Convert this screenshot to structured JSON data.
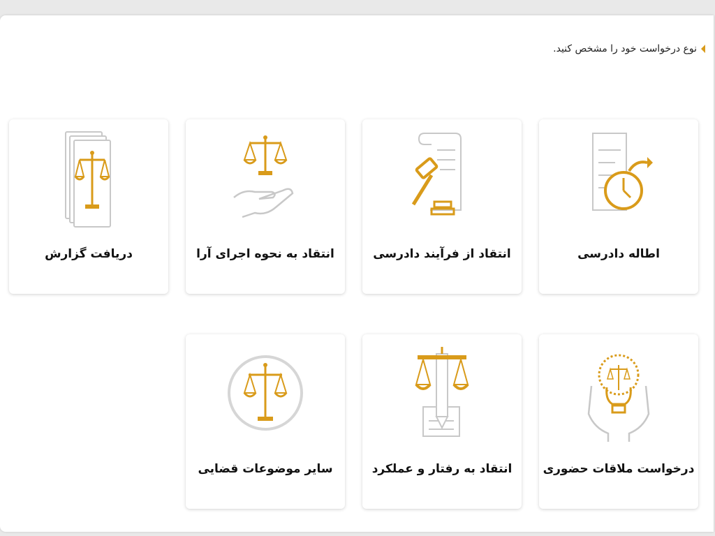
{
  "prompt": {
    "text": "نوع درخواست خود را مشخص کنید."
  },
  "colors": {
    "accent": "#d99b1a",
    "icon_gray": "#c8c8c8"
  },
  "cards": [
    {
      "label": "اطاله دادرسی",
      "icon": "clock-document-icon"
    },
    {
      "label": "انتقاد از فرآیند دادرسی",
      "icon": "gavel-scroll-icon"
    },
    {
      "label": "انتقاد به نحوه اجرای آرا",
      "icon": "scales-hand-icon"
    },
    {
      "label": "دریافت گزارش",
      "icon": "scales-documents-icon"
    },
    {
      "label": "درخواست ملاقات حضوری",
      "icon": "lightbulb-hands-icon"
    },
    {
      "label": "انتقاد به رفتار و عملکرد",
      "icon": "scales-pencil-icon"
    },
    {
      "label": "سایر موضوعات قضایی",
      "icon": "scales-circle-icon"
    }
  ]
}
